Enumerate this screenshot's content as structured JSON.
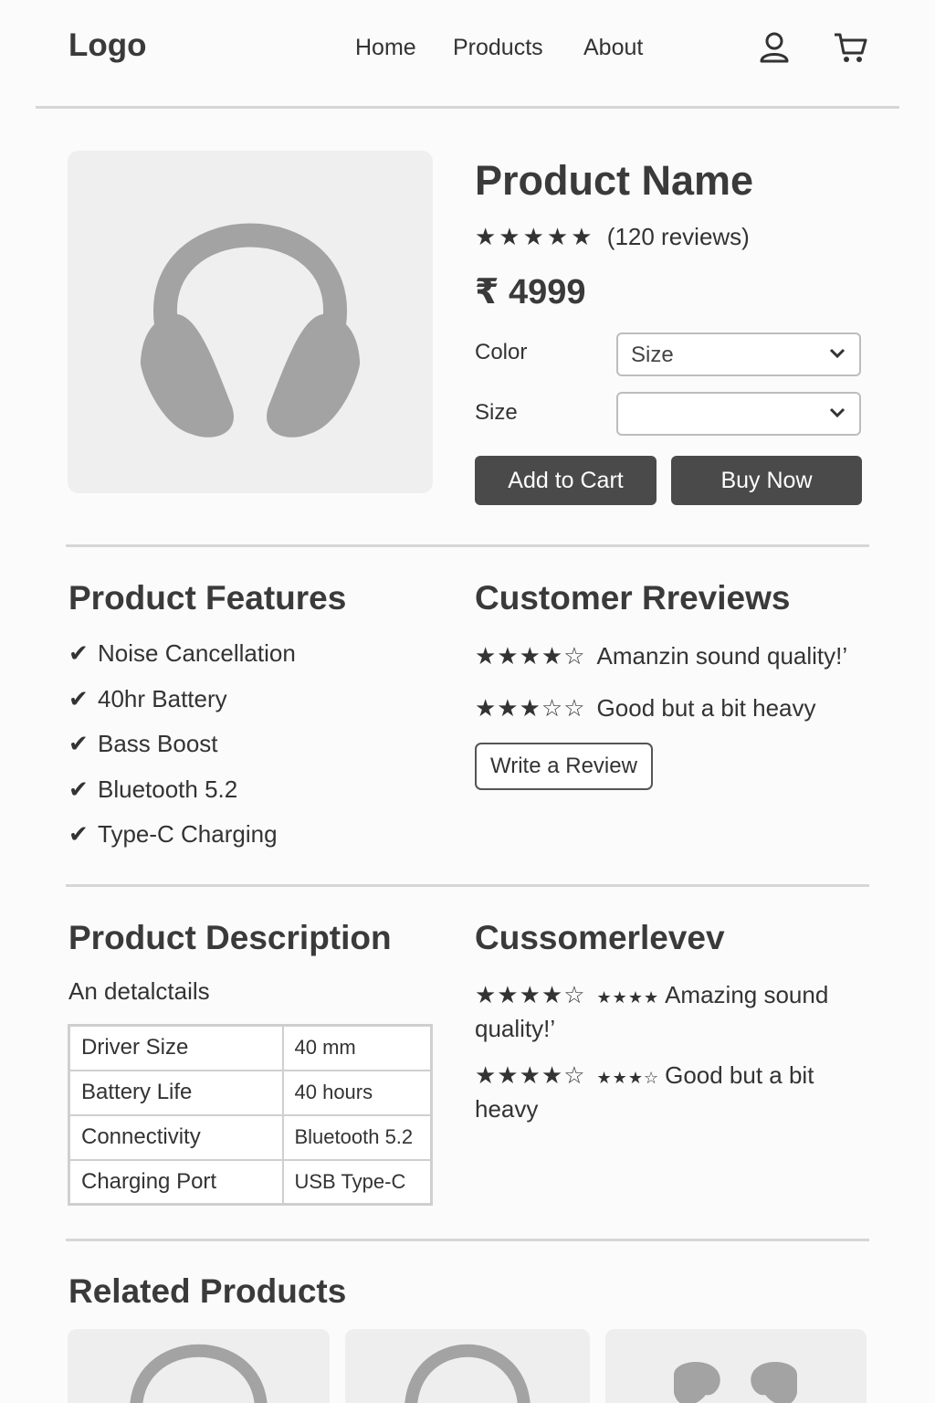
{
  "header": {
    "logo": "Logo",
    "nav": [
      "Home",
      "Products",
      "About"
    ],
    "icons": [
      "user-icon",
      "cart-icon"
    ]
  },
  "product": {
    "image_icon": "headphones-icon",
    "name": "Product Name",
    "rating_stars": "★★★★★",
    "reviews_count": "(120 reviews)",
    "price": "₹ 4999",
    "color_label": "Color",
    "color_value": "Size",
    "size_label": "Size",
    "size_value": "",
    "add_to_cart": "Add to Cart",
    "buy_now": "Buy Now"
  },
  "features": {
    "title": "Product Features",
    "items": [
      "Noise Cancellation",
      "40hr Battery",
      "Bass Boost",
      "Bluetooth 5.2",
      "Type-C Charging"
    ]
  },
  "reviews": {
    "title": "Customer Rreviews",
    "items": [
      {
        "stars": "★★★★☆",
        "text": "Amanzin sound quality!’"
      },
      {
        "stars": "★★★☆☆",
        "text": "Good but a bit heavy"
      }
    ],
    "write_review": "Write a Review"
  },
  "description": {
    "title": "Product Description",
    "text": "An detalctails",
    "specs": [
      {
        "key": "Driver Size",
        "value": "40 mm"
      },
      {
        "key": "Battery Life",
        "value": "40 hours"
      },
      {
        "key": "Connectivity",
        "value": "Bluetooth 5.2"
      },
      {
        "key": "Charging Port",
        "value": "USB Type-C"
      }
    ]
  },
  "reviews2": {
    "title": "Cussomerlevev",
    "items": [
      {
        "stars": "★★★★☆",
        "mini": "★★★★",
        "text": "Amazing sound quality!’"
      },
      {
        "stars": "★★★★☆",
        "mini": "★★★☆",
        "text": "Good but a bit heavy"
      }
    ]
  },
  "related": {
    "title": "Related Products",
    "cards": [
      "headphones-icon",
      "headphones-icon",
      "earbuds-icon"
    ]
  }
}
